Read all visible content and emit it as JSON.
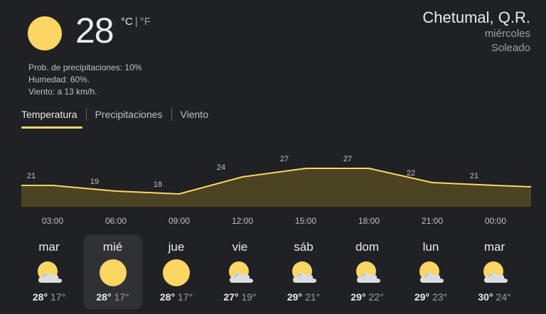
{
  "current": {
    "temperature": "28",
    "unit_c": "°C",
    "unit_sep": "|",
    "unit_f": "°F",
    "icon": "sun-icon",
    "precip": "Prob. de precipitaciones: 10%",
    "humidity": "Humedad: 60%.",
    "wind": "Viento: a 13 km/h."
  },
  "location": {
    "city": "Chetumal, Q.R.",
    "day": "miércoles",
    "condition": "Soleado"
  },
  "tabs": [
    {
      "label": "Temperatura",
      "active": true
    },
    {
      "label": "Precipitaciones",
      "active": false
    },
    {
      "label": "Viento",
      "active": false
    }
  ],
  "colors": {
    "accent": "#fdd663",
    "fill": "#4b4322",
    "background": "#202124"
  },
  "chart_data": {
    "type": "area",
    "x": [
      "03:00",
      "06:00",
      "09:00",
      "12:00",
      "15:00",
      "18:00",
      "21:00",
      "00:00"
    ],
    "values": [
      21,
      19,
      18,
      24,
      27,
      27,
      22,
      21
    ],
    "data_labels": [
      "21",
      "19",
      "18",
      "24",
      "27",
      "27",
      "22",
      "21"
    ]
  },
  "days": [
    {
      "name": "mar",
      "icon": "partly-cloudy-icon",
      "hi": "28°",
      "lo": "17°",
      "selected": false
    },
    {
      "name": "mié",
      "icon": "sun-icon",
      "hi": "28°",
      "lo": "17°",
      "selected": true
    },
    {
      "name": "jue",
      "icon": "sun-icon",
      "hi": "28°",
      "lo": "17°",
      "selected": false
    },
    {
      "name": "vie",
      "icon": "partly-cloudy-icon",
      "hi": "27°",
      "lo": "19°",
      "selected": false
    },
    {
      "name": "sáb",
      "icon": "partly-cloudy-icon",
      "hi": "29°",
      "lo": "21°",
      "selected": false
    },
    {
      "name": "dom",
      "icon": "partly-cloudy-icon",
      "hi": "29°",
      "lo": "22°",
      "selected": false
    },
    {
      "name": "lun",
      "icon": "partly-cloudy-icon",
      "hi": "29°",
      "lo": "23°",
      "selected": false
    },
    {
      "name": "mar",
      "icon": "partly-cloudy-icon",
      "hi": "30°",
      "lo": "24°",
      "selected": false
    }
  ]
}
